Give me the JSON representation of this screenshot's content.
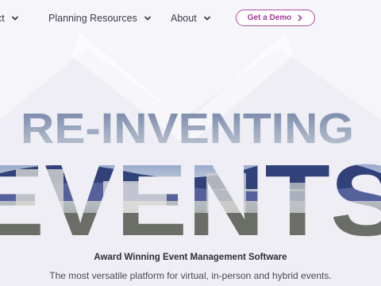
{
  "nav": {
    "items": [
      {
        "label": "ct"
      },
      {
        "label": "Planning Resources"
      },
      {
        "label": "About"
      }
    ],
    "cta_label": "Get a Demo"
  },
  "hero": {
    "headline_line1": "RE-INVENTING",
    "headline_line2": "EVENTS",
    "tagline": "Award Winning Event Management Software",
    "subline": "The most versatile platform for virtual, in-person and hybrid events."
  },
  "colors": {
    "accent": "#a43c97",
    "background": "#f6f6fa",
    "text": "#2d2d3a"
  },
  "icons": [
    "chevron-down-icon",
    "chevron-right-icon"
  ]
}
